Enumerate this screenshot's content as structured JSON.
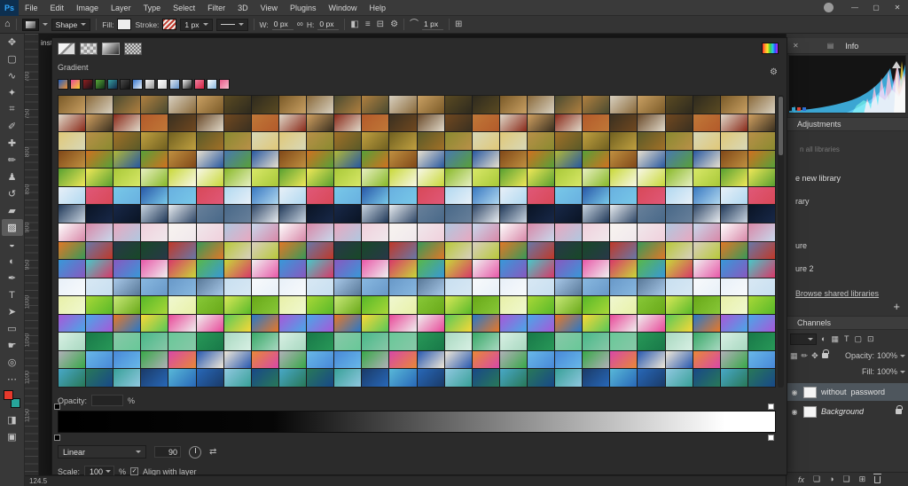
{
  "app": {
    "logo": "Ps",
    "doc_tab": "inst",
    "status_zoom": "124.5"
  },
  "icons": {
    "home": "⌂",
    "gear": "⚙",
    "link": "∞",
    "arc": "⌒",
    "check": "✓",
    "close_tab": "✕",
    "panel_mini": "▤",
    "reverse": "⇄",
    "eye": "◉",
    "plus": "+",
    "percent": "%"
  },
  "menubar": {
    "items": [
      "File",
      "Edit",
      "Image",
      "Layer",
      "Type",
      "Select",
      "Filter",
      "3D",
      "View",
      "Plugins",
      "Window",
      "Help"
    ],
    "window_buttons": [
      {
        "name": "minimize-button",
        "glyph": "—"
      },
      {
        "name": "maximize-button",
        "glyph": "▢"
      },
      {
        "name": "close-button",
        "glyph": "✕"
      }
    ]
  },
  "options_bar": {
    "tool_mode": "Shape",
    "fill_label": "Fill:",
    "stroke_label": "Stroke:",
    "stroke_width": "1 px",
    "w_label": "W:",
    "w_value": "0 px",
    "h_label": "H:",
    "h_value": "0 px",
    "corner_radius": "1 px",
    "mid_icons": [
      {
        "name": "path-operations-icon",
        "glyph": "◧"
      },
      {
        "name": "path-align-icon",
        "glyph": "≡"
      },
      {
        "name": "path-arrange-icon",
        "glyph": "⊟"
      },
      {
        "name": "gear-icon",
        "glyph": "⚙"
      }
    ],
    "end_icons": [
      {
        "name": "align-edges-icon",
        "glyph": "⊞"
      }
    ]
  },
  "toolbar": {
    "foreground_color": "#e8392c",
    "background_color": "#27a49a",
    "tools": [
      {
        "name": "move-tool",
        "glyph": "✥"
      },
      {
        "name": "marquee-tool",
        "glyph": "▢"
      },
      {
        "name": "lasso-tool",
        "glyph": "∿"
      },
      {
        "name": "object-selection-tool",
        "glyph": "✦"
      },
      {
        "name": "crop-tool",
        "glyph": "⌗"
      },
      {
        "name": "eyedropper-tool",
        "glyph": "✐"
      },
      {
        "name": "healing-brush-tool",
        "glyph": "✚"
      },
      {
        "name": "brush-tool",
        "glyph": "✏"
      },
      {
        "name": "clone-stamp-tool",
        "glyph": "♟"
      },
      {
        "name": "history-brush-tool",
        "glyph": "↺"
      },
      {
        "name": "eraser-tool",
        "glyph": "▰"
      },
      {
        "name": "gradient-tool",
        "glyph": "▨",
        "selected": true
      },
      {
        "name": "blur-tool",
        "glyph": "◒"
      },
      {
        "name": "dodge-tool",
        "glyph": "◐"
      },
      {
        "name": "pen-tool",
        "glyph": "✒"
      },
      {
        "name": "type-tool",
        "glyph": "T"
      },
      {
        "name": "path-selection-tool",
        "glyph": "➤"
      },
      {
        "name": "rectangle-tool",
        "glyph": "▭"
      },
      {
        "name": "hand-tool",
        "glyph": "☛"
      },
      {
        "name": "zoom-tool",
        "glyph": "◎"
      },
      {
        "name": "edit-toolbar-icon",
        "glyph": "⋯"
      }
    ],
    "bottom_tools": [
      {
        "name": "quick-mask-icon",
        "glyph": "◨"
      },
      {
        "name": "screen-mode-icon",
        "glyph": "▣"
      }
    ]
  },
  "ruler": {
    "labels": [
      "700",
      "750",
      "800",
      "850",
      "900",
      "950",
      "1000",
      "1050",
      "1100",
      "1150"
    ]
  },
  "gradient_panel": {
    "section_label": "Gradient",
    "opacity_label": "Opacity:",
    "opacity_value": "",
    "opacity_unit": "%",
    "gradient_type": "Linear",
    "angle_value": "90",
    "scale_label": "Scale:",
    "scale_value": "100",
    "scale_unit": "%",
    "align_checkbox_label": "Align with layer",
    "recent_swatches": [
      [
        "#2060c0",
        "#f09030"
      ],
      [
        "#e84898",
        "#f8d030"
      ],
      [
        "#902020",
        "#181018"
      ],
      [
        "#58a838",
        "#103018"
      ],
      [
        "#38a0a0",
        "#102848"
      ],
      [
        "#484848",
        "#101010"
      ],
      [
        "#3878d0",
        "#e8f0f8"
      ],
      [
        "#f8f8f8",
        "#909090"
      ],
      [
        "#ffffff",
        "#d0d0d0"
      ],
      [
        "#e0e8f0",
        "#6090c8"
      ],
      [
        "#f0f0f0",
        "#202020"
      ],
      [
        "#f080a0",
        "#d02040"
      ],
      [
        "#ffffff",
        "#88b8e0"
      ],
      [
        "#e85888",
        "#f8c0d0"
      ]
    ],
    "grid": {
      "cols": 26,
      "rows": 16,
      "row_palettes": [
        [
          "#7a5a28",
          "#c9a063",
          "#4a4a30",
          "#2e2a1e",
          "#d8d0c0",
          "#8a6a3a",
          "#5a4a22",
          "#b08040"
        ],
        [
          "#b35a2a",
          "#e0d8c8",
          "#6a4a2a",
          "#8a2a1a",
          "#c07838",
          "#3a3020",
          "#d0a060",
          "#704820"
        ],
        [
          "#8a8a30",
          "#c0a040",
          "#e0c878",
          "#5a5a28",
          "#a07028",
          "#d8d8b8",
          "#706020",
          "#b89048"
        ],
        [
          "#d07020",
          "#4878b0",
          "#58a038",
          "#804818",
          "#e8e0d0",
          "#b0b838",
          "#2858a0",
          "#c09040"
        ],
        [
          "#c8d838",
          "#f0e858",
          "#88b828",
          "#e8f0c0",
          "#58a030",
          "#f8f8e8",
          "#a8c838",
          "#d8e868"
        ],
        [
          "#3878c0",
          "#68b0e0",
          "#e05878",
          "#b0d8f0",
          "#2858a8",
          "#e8f0f8",
          "#d84858",
          "#78c8e8"
        ],
        [
          "#182848",
          "#304868",
          "#e8ecf0",
          "#0a1424",
          "#486888",
          "#c8d4e0",
          "#203858",
          "#68809a"
        ],
        [
          "#f0e8ec",
          "#e8a8c0",
          "#c8d8ec",
          "#f8f4f0",
          "#d888a8",
          "#b0c8e0",
          "#f0d0dc",
          "#ffffff"
        ],
        [
          "#e07828",
          "#389858",
          "#283848",
          "#d8d0c0",
          "#c03828",
          "#6878a8",
          "#b8c838",
          "#184828"
        ],
        [
          "#e858a8",
          "#3898d8",
          "#58b848",
          "#8858c0",
          "#f0f0f0",
          "#d83868",
          "#48c8c8",
          "#c8d838"
        ],
        [
          "#c8dff0",
          "#88b8e0",
          "#e8f0f8",
          "#587898",
          "#a8c8e8",
          "#f8fafc",
          "#6898c8",
          "#d8e8f4"
        ],
        [
          "#a8d838",
          "#d8e858",
          "#58b828",
          "#e8f0a8",
          "#88c838",
          "#c8e878",
          "#68a818",
          "#f0f8d0"
        ],
        [
          "#e84898",
          "#48a8e8",
          "#58c858",
          "#f8d838",
          "#a858d8",
          "#f0f0f0",
          "#e87828",
          "#2878c8"
        ],
        [
          "#38a868",
          "#68c898",
          "#187848",
          "#a8d8c0",
          "#48b888",
          "#d8f0e4",
          "#289858",
          "#88c8a8"
        ],
        [
          "#4888d8",
          "#e88838",
          "#d848a8",
          "#68b8e8",
          "#f0e8d8",
          "#38a848",
          "#b0b0b8",
          "#2858b0"
        ],
        [
          "#2868b8",
          "#38a098",
          "#184888",
          "#58b8d8",
          "#287858",
          "#90c8e0",
          "#1a3a68",
          "#48a8c8"
        ]
      ]
    }
  },
  "panels": {
    "info_tab": "Info",
    "adjustments_title": "Adjustments",
    "libraries": {
      "search_hint": "n all libraries",
      "create_label": "e new library",
      "items": [
        "rary",
        "ure",
        "ure 2"
      ],
      "browse_link": "Browse shared libraries",
      "add_button": "+"
    },
    "channels_title": "Channels",
    "layers": {
      "filter_icons": [
        {
          "name": "adjustment-filter-icon",
          "glyph": "◐"
        },
        {
          "name": "pixel-filter-icon",
          "glyph": "▦"
        },
        {
          "name": "type-filter-icon",
          "glyph": "T"
        },
        {
          "name": "shape-filter-icon",
          "glyph": "▢"
        },
        {
          "name": "smart-object-filter-icon",
          "glyph": "⊡"
        }
      ],
      "lock_icons": [
        {
          "name": "lock-transparent-icon",
          "glyph": "▦"
        },
        {
          "name": "lock-pixels-icon",
          "glyph": "✏"
        },
        {
          "name": "lock-position-icon",
          "glyph": "✥"
        }
      ],
      "opacity_label": "Opacity:",
      "opacity_value": "100%",
      "fill_label": "Fill:",
      "fill_value": "100%",
      "rows": [
        {
          "label": "without  password"
        },
        {
          "label": "Background"
        }
      ],
      "fx_label": "fx",
      "bottom_icons": [
        {
          "name": "layer-mask-icon",
          "glyph": "❏"
        },
        {
          "name": "adjustment-layer-icon",
          "glyph": "◑"
        },
        {
          "name": "layer-group-icon",
          "glyph": "❑"
        },
        {
          "name": "new-layer-icon",
          "glyph": "⊞"
        }
      ]
    }
  }
}
